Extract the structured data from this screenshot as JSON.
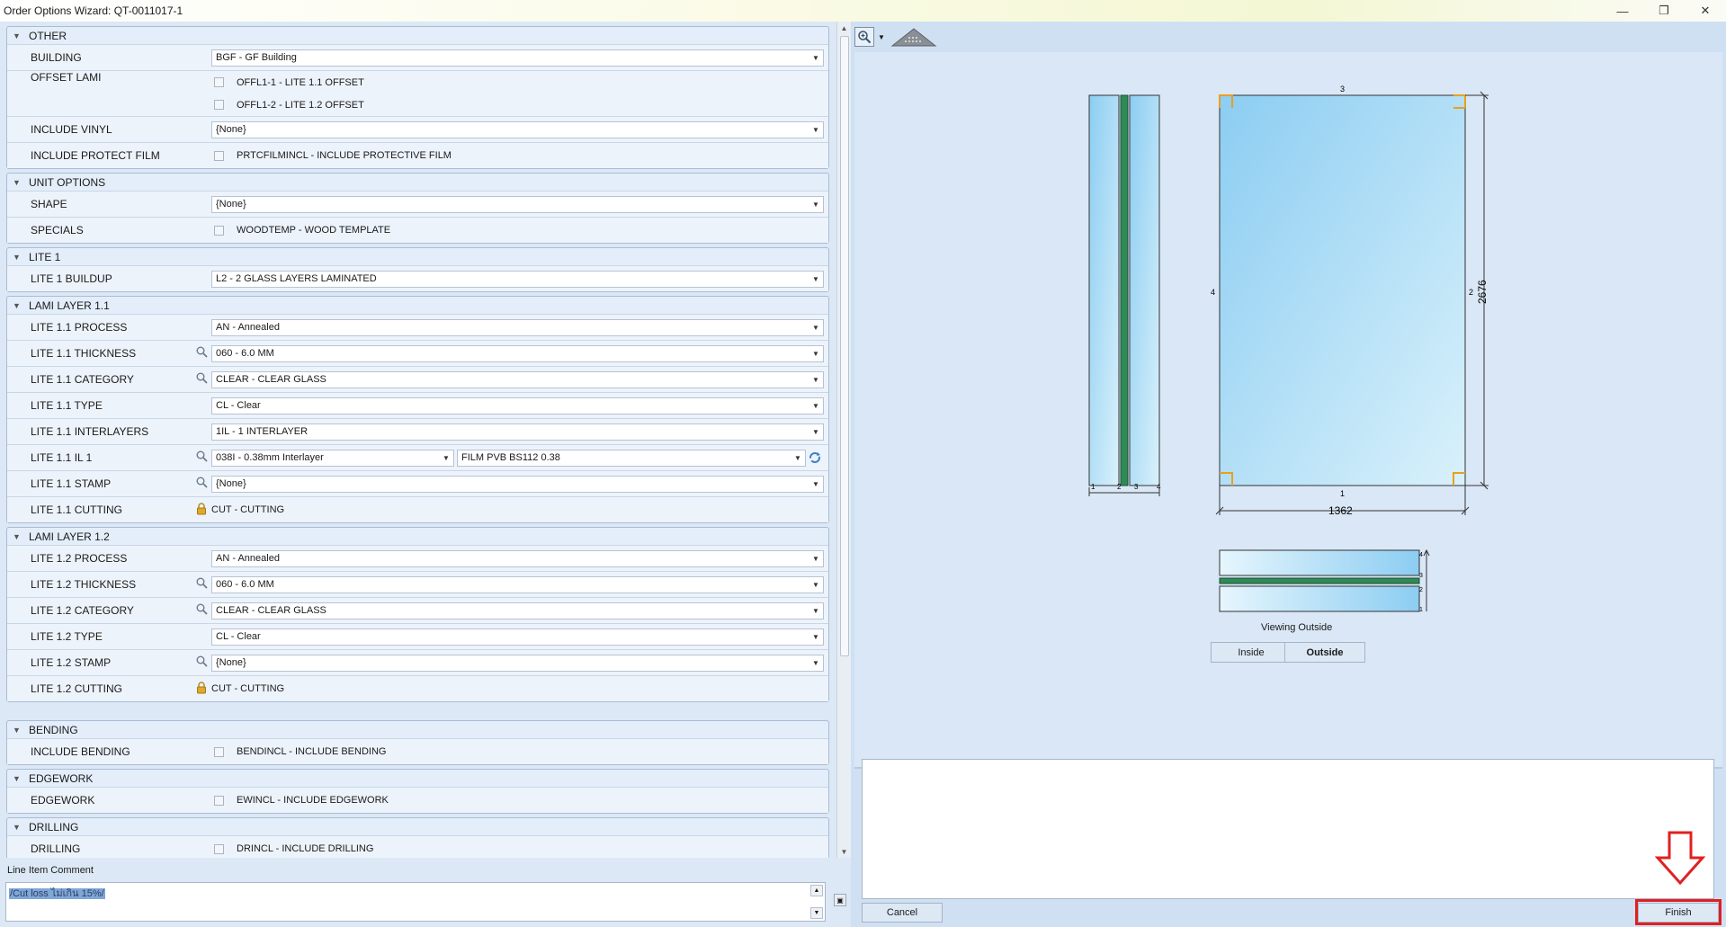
{
  "window": {
    "title": "Order Options Wizard: QT-0011017-1",
    "controls": [
      "—",
      "❐",
      "✕"
    ]
  },
  "groups": [
    {
      "title": "OTHER",
      "rows": [
        {
          "label": "BUILDING",
          "type": "combo",
          "value": "BGF - GF Building"
        },
        {
          "label": "OFFSET LAMI",
          "type": "checklist",
          "items": [
            "OFFL1-1 - LITE 1.1 OFFSET",
            "OFFL1-2 - LITE 1.2 OFFSET"
          ]
        },
        {
          "label": "INCLUDE VINYL",
          "type": "combo",
          "value": "{None}"
        },
        {
          "label": "INCLUDE PROTECT FILM",
          "type": "checklist",
          "items": [
            "PRTCFILMINCL - INCLUDE PROTECTIVE FILM"
          ]
        }
      ]
    },
    {
      "title": "UNIT OPTIONS",
      "rows": [
        {
          "label": "SHAPE",
          "type": "combo",
          "value": "{None}"
        },
        {
          "label": "SPECIALS",
          "type": "checklist",
          "items": [
            "WOODTEMP - WOOD TEMPLATE"
          ]
        }
      ]
    },
    {
      "title": "LITE 1",
      "rows": [
        {
          "label": "LITE 1 BUILDUP",
          "type": "combo",
          "value": "L2 - 2 GLASS LAYERS LAMINATED"
        }
      ]
    },
    {
      "title": "LAMI LAYER 1.1",
      "rows": [
        {
          "label": "LITE 1.1 PROCESS",
          "type": "combo",
          "value": "AN - Annealed"
        },
        {
          "label": "LITE 1.1 THICKNESS",
          "type": "combo",
          "value": "060 - 6.0 MM",
          "icon": "search"
        },
        {
          "label": "LITE 1.1 CATEGORY",
          "type": "combo",
          "value": "CLEAR - CLEAR GLASS",
          "icon": "search"
        },
        {
          "label": "LITE 1.1 TYPE",
          "type": "combo",
          "value": "CL - Clear"
        },
        {
          "label": "LITE 1.1 INTERLAYERS",
          "type": "combo",
          "value": "1IL - 1 INTERLAYER"
        },
        {
          "label": "LITE 1.1 IL 1",
          "type": "double",
          "value": "038I - 0.38mm Interlayer",
          "value2": "FILM PVB BS112 0.38",
          "icon": "search"
        },
        {
          "label": "LITE 1.1 STAMP",
          "type": "combo",
          "value": "{None}",
          "icon": "search"
        },
        {
          "label": "LITE 1.1 CUTTING",
          "type": "static",
          "value": "CUT - CUTTING",
          "icon": "lock"
        }
      ]
    },
    {
      "title": "LAMI LAYER 1.2",
      "rows": [
        {
          "label": "LITE 1.2 PROCESS",
          "type": "combo",
          "value": "AN - Annealed"
        },
        {
          "label": "LITE 1.2 THICKNESS",
          "type": "combo",
          "value": "060 - 6.0 MM",
          "icon": "search"
        },
        {
          "label": "LITE 1.2 CATEGORY",
          "type": "combo",
          "value": "CLEAR - CLEAR GLASS",
          "icon": "search"
        },
        {
          "label": "LITE 1.2 TYPE",
          "type": "combo",
          "value": "CL - Clear"
        },
        {
          "label": "LITE 1.2 STAMP",
          "type": "combo",
          "value": "{None}",
          "icon": "search"
        },
        {
          "label": "LITE 1.2 CUTTING",
          "type": "static",
          "value": "CUT - CUTTING",
          "icon": "lock"
        }
      ]
    },
    {
      "title": "BENDING",
      "rows": [
        {
          "label": "INCLUDE BENDING",
          "type": "checklist",
          "items": [
            "BENDINCL - INCLUDE BENDING"
          ]
        }
      ]
    },
    {
      "title": "EDGEWORK",
      "rows": [
        {
          "label": "EDGEWORK",
          "type": "checklist",
          "items": [
            "EWINCL - INCLUDE EDGEWORK"
          ]
        }
      ]
    },
    {
      "title": "DRILLING",
      "rows": [
        {
          "label": "DRILLING",
          "type": "checklist",
          "items": [
            "DRINCL - INCLUDE DRILLING"
          ]
        }
      ]
    }
  ],
  "comment": {
    "label": "Line Item Comment",
    "text": "/Cut loss ไม่เกิน 15%/"
  },
  "preview": {
    "edge_labels": {
      "top": "3",
      "left": "4",
      "right": "2",
      "bottom": "1"
    },
    "width_dim": "1362",
    "height_dim": "2676",
    "side_labels": [
      "1",
      "2",
      "3",
      "4"
    ],
    "section_labels": [
      "4",
      "3",
      "2",
      "1"
    ],
    "viewing_text": "Viewing Outside",
    "inside_label": "Inside",
    "outside_label": "Outside",
    "glass_color": "#9fd3f2",
    "interlayer_color": "#2e8b57",
    "corner_color": "#e8a020"
  },
  "buttons": {
    "cancel": "Cancel",
    "finish": "Finish"
  },
  "highlight_color": "#e02020"
}
